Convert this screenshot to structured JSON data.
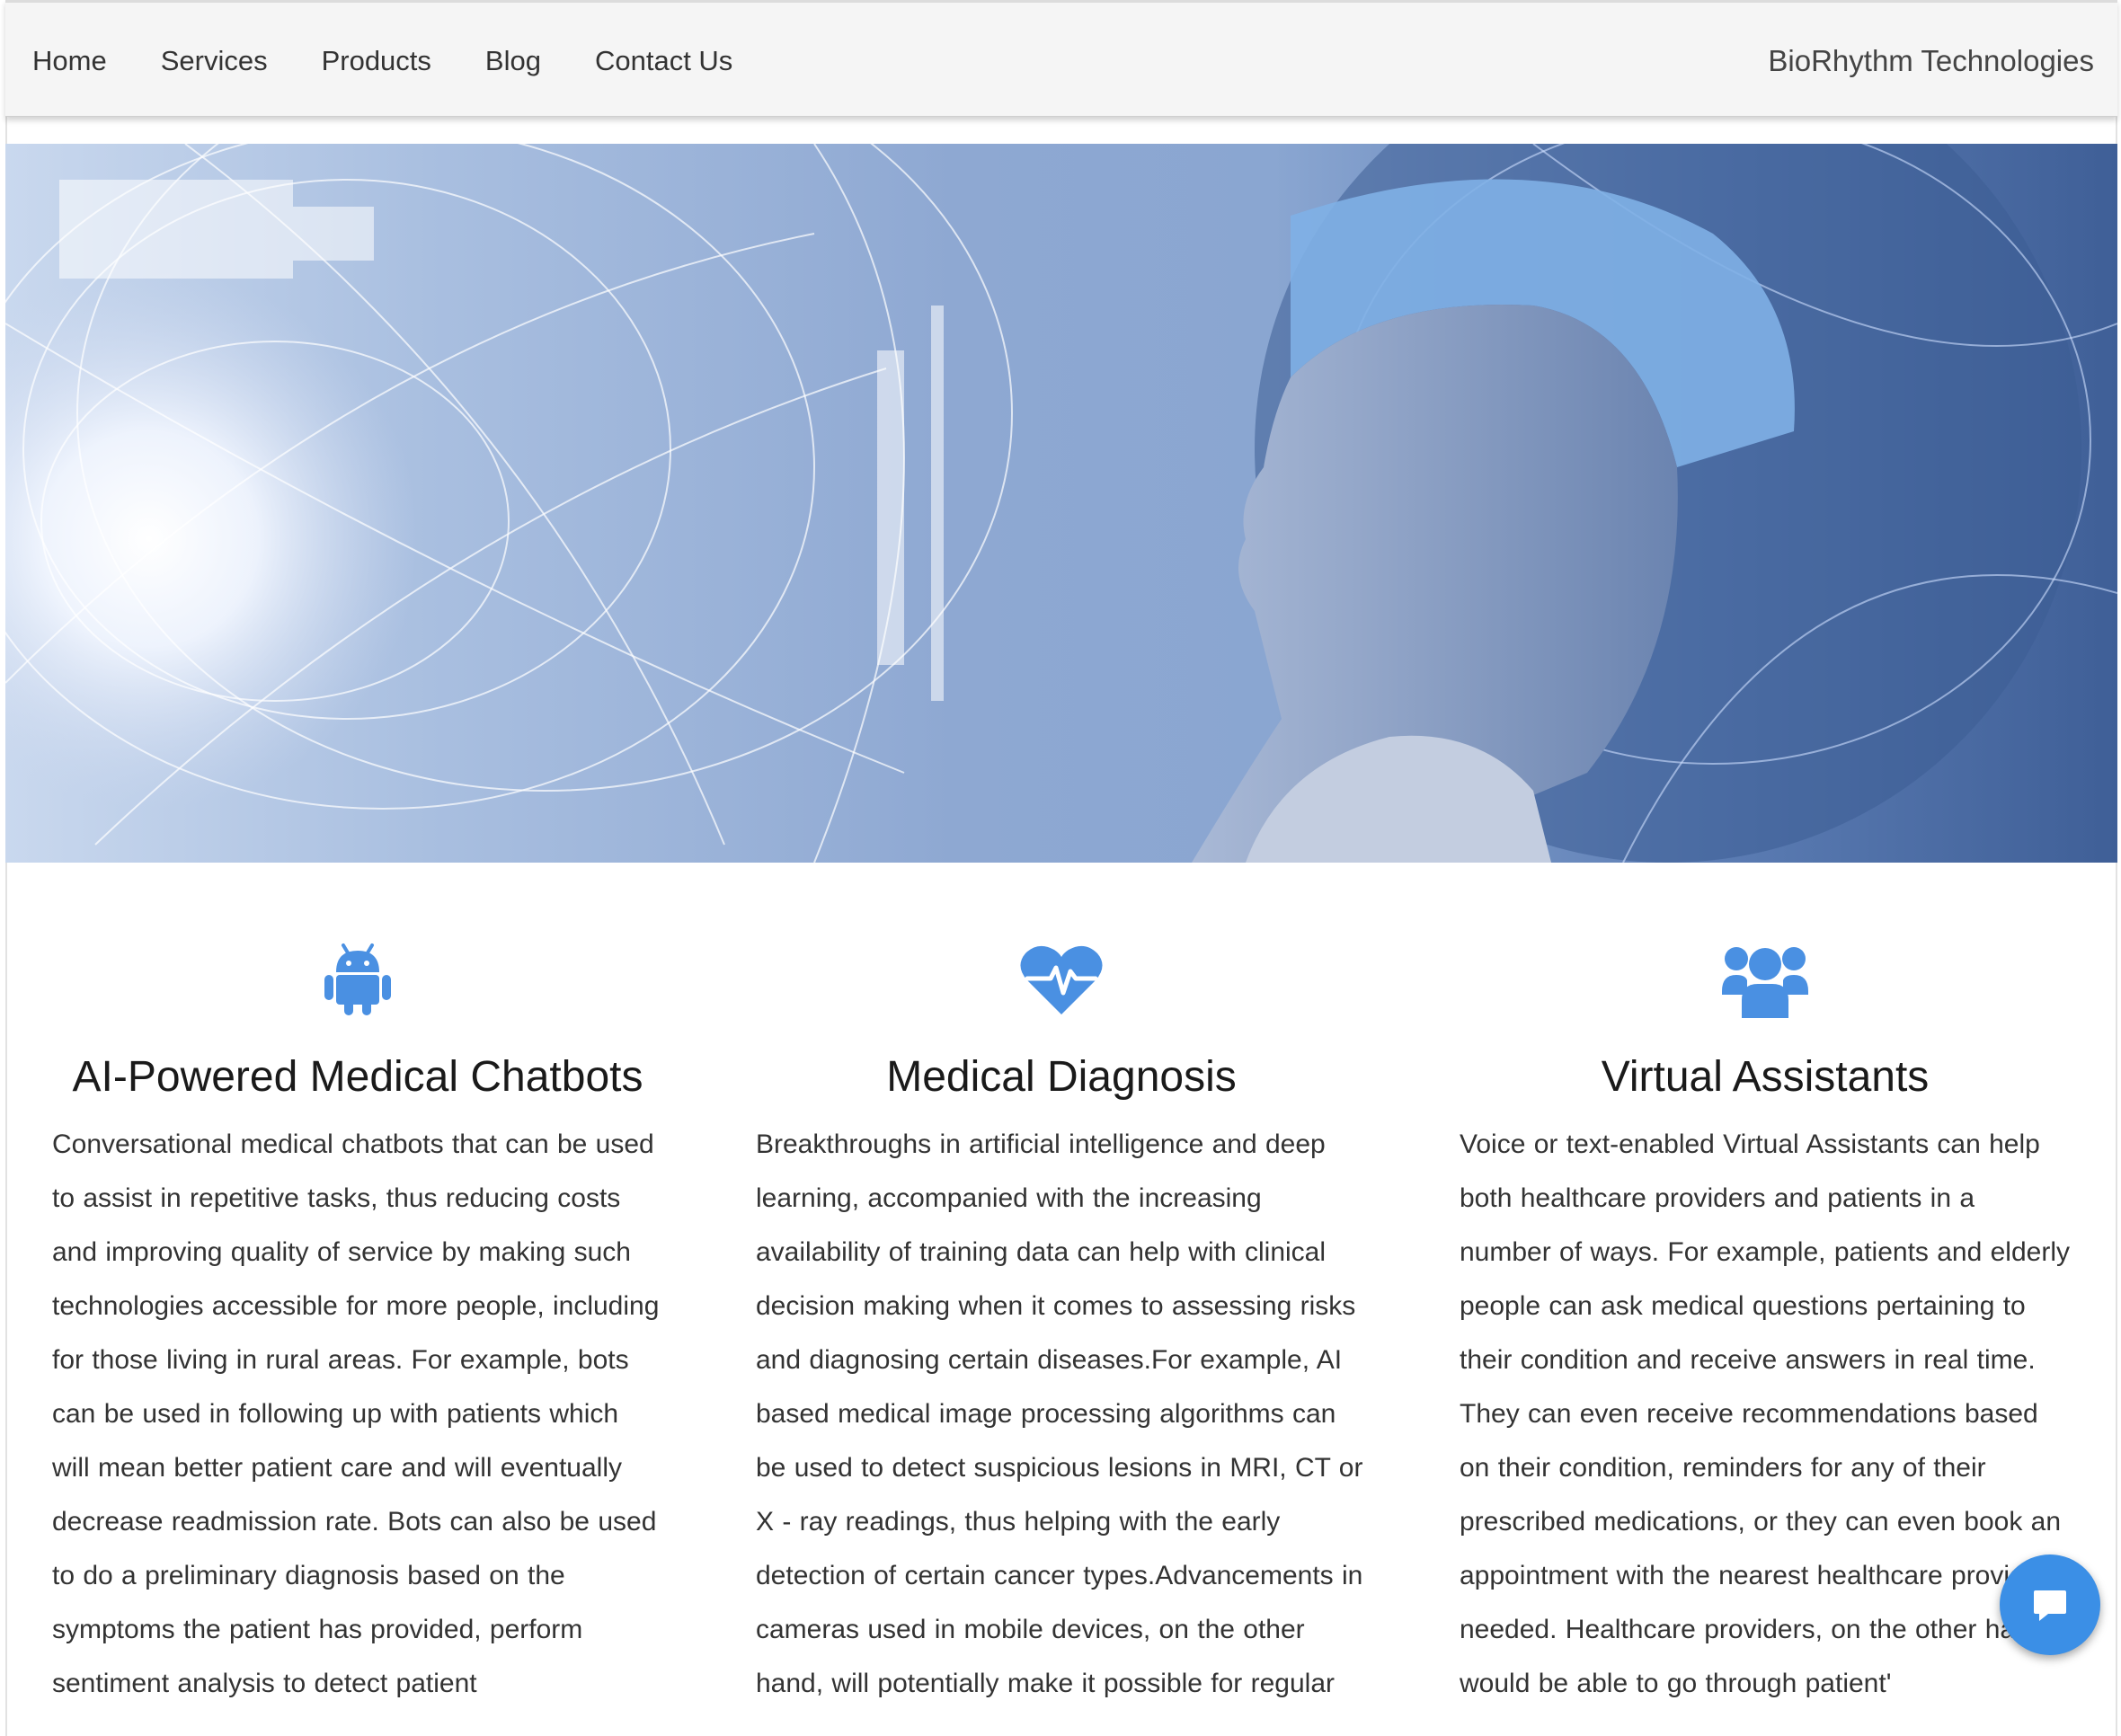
{
  "nav": {
    "links": [
      "Home",
      "Services",
      "Products",
      "Blog",
      "Contact Us"
    ],
    "brand": "BioRhythm Technologies"
  },
  "hero": {
    "icon": "doctor-with-digital-network-banner"
  },
  "features": [
    {
      "icon": "android-icon",
      "title": "AI-Powered Medical Chatbots",
      "text": "Conversational medical chatbots that can be used to assist in repetitive tasks, thus reducing costs and improving quality of service by making such technologies accessible for more people, including for those living in rural areas. For example, bots can be used in following up with patients which will mean better patient care and will eventually decrease readmission rate. Bots can also be used to do a preliminary diagnosis based on the symptoms the patient has provided, perform sentiment analysis to detect patient"
    },
    {
      "icon": "heartbeat-icon",
      "title": "Medical Diagnosis",
      "text": "Breakthroughs in artificial intelligence and deep learning, accompanied with the increasing availability of training data can help with clinical decision making when it comes to assessing risks and diagnosing certain diseases.For example, AI based medical image processing algorithms can be used to detect suspicious lesions in MRI, CT or X - ray readings, thus helping with the early detection of certain cancer types.Advancements in cameras used in mobile devices, on the other hand, will potentially make it possible for regular"
    },
    {
      "icon": "users-icon",
      "title": "Virtual Assistants",
      "text": "Voice or text-enabled Virtual Assistants can help both healthcare providers and patients in a number of ways. For example, patients and elderly people can ask medical questions pertaining to their condition and receive answers in real time. They can even receive recommendations based on their condition, reminders for any of their prescribed medications, or they can even book an appointment with the nearest healthcare provider if needed. Healthcare providers, on the other hand, would be able to go through patient'"
    }
  ],
  "colors": {
    "accent": "#4a90e2",
    "fab": "#3b8fe6"
  },
  "chat": {
    "icon": "chat-bubble-icon"
  }
}
